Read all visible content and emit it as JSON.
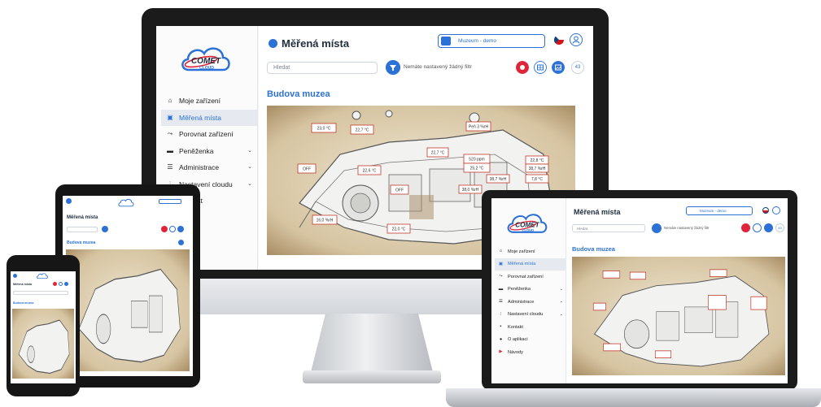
{
  "app": {
    "logo_text": "COMET",
    "logo_subtext": "CLOUD",
    "page_title": "Měřená místa",
    "account_label": "Muzeum - demo",
    "search_placeholder": "Hledat",
    "filter_text": "Nemáte nastavený žádný filtr",
    "device_count": "43",
    "section_title": "Budova muzea"
  },
  "sidebar": {
    "items": [
      {
        "label": "Moje zařízení",
        "icon": "home-icon",
        "active": false,
        "chevron": false
      },
      {
        "label": "Měřená místa",
        "icon": "places-icon",
        "active": true,
        "chevron": false
      },
      {
        "label": "Porovnat zařízení",
        "icon": "compare-icon",
        "active": false,
        "chevron": false
      },
      {
        "label": "Peněženka",
        "icon": "wallet-icon",
        "active": false,
        "chevron": true
      },
      {
        "label": "Administrace",
        "icon": "list-icon",
        "active": false,
        "chevron": true
      },
      {
        "label": "Nastavení cloudu",
        "icon": "sliders-icon",
        "active": false,
        "chevron": true
      },
      {
        "label": "Kontakt",
        "icon": "contact-icon",
        "active": false,
        "chevron": false
      }
    ],
    "laptop_extra_items": [
      {
        "label": "O aplikaci",
        "icon": "info-icon"
      },
      {
        "label": "Návody",
        "icon": "youtube-icon"
      }
    ]
  },
  "map_labels": [
    {
      "text": "23,0 °C"
    },
    {
      "text": "22,7 °C"
    },
    {
      "text": "Peň 3 %rH"
    },
    {
      "text": "22,7 °C"
    },
    {
      "text": "520 ppm"
    },
    {
      "text": "25,2 °C"
    },
    {
      "text": "22,8 °C"
    },
    {
      "text": "38,7 %rH"
    },
    {
      "text": "OFF"
    },
    {
      "text": "22,6 °C"
    },
    {
      "text": "38,7 %rH"
    },
    {
      "text": "7,8 °C"
    },
    {
      "text": "OFF"
    },
    {
      "text": "38,0 %rH"
    },
    {
      "text": "16,0 %rH"
    },
    {
      "text": "22,0 °C"
    }
  ],
  "colors": {
    "accent": "#2c72d6",
    "alert_red": "#e0243a",
    "label_border": "#c0392b"
  }
}
